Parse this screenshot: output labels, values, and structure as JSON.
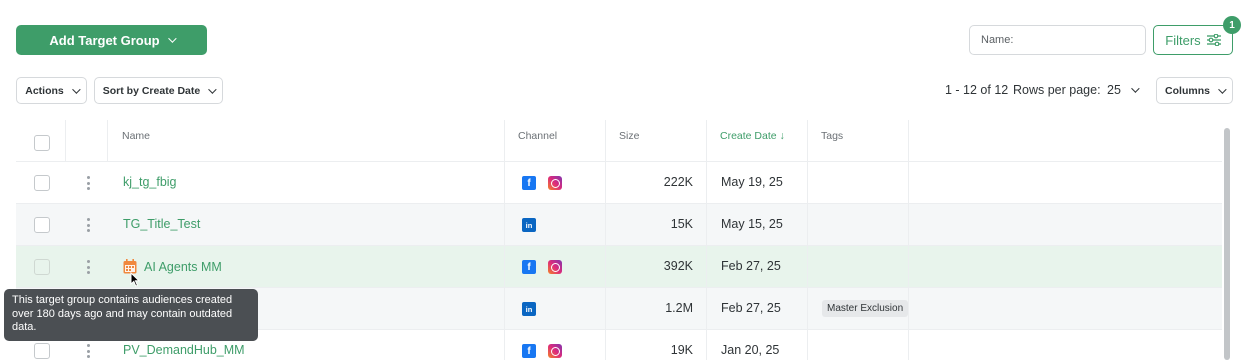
{
  "toolbar": {
    "add_target_group_label": "Add Target Group",
    "name_placeholder": "Name:",
    "filters_label": "Filters",
    "filters_count": "1"
  },
  "controls": {
    "actions_label": "Actions",
    "sort_label": "Sort by Create Date",
    "pagination_text": "1 - 12 of 12",
    "rows_per_page_label": "Rows per page:",
    "rows_per_page_value": "25",
    "columns_label": "Columns"
  },
  "table": {
    "headers": {
      "name": "Name",
      "channel": "Channel",
      "size": "Size",
      "create_date": "Create Date ↓",
      "tags": "Tags"
    },
    "rows": [
      {
        "name": "kj_tg_fbig",
        "channels": [
          "facebook",
          "instagram"
        ],
        "size": "222K",
        "date": "May 19, 25",
        "tag": ""
      },
      {
        "name": "TG_Title_Test",
        "channels": [
          "linkedin"
        ],
        "size": "15K",
        "date": "May 15, 25",
        "tag": ""
      },
      {
        "name": "AI Agents MM",
        "channels": [
          "facebook",
          "instagram"
        ],
        "size": "392K",
        "date": "Feb 27, 25",
        "tag": ""
      },
      {
        "name": "",
        "channels": [
          "linkedin"
        ],
        "size": "1.2M",
        "date": "Feb 27, 25",
        "tag": "Master Exclusion"
      },
      {
        "name": "PV_DemandHub_MM",
        "channels": [
          "facebook",
          "instagram"
        ],
        "size": "19K",
        "date": "Jan 20, 25",
        "tag": ""
      }
    ]
  },
  "tooltip": {
    "text": "This target group contains audiences created over 180 days ago and may contain outdated data."
  },
  "colors": {
    "accent": "#3e9d69",
    "highlight_row": "#e8f4ec",
    "warning_icon": "#f0883e"
  }
}
